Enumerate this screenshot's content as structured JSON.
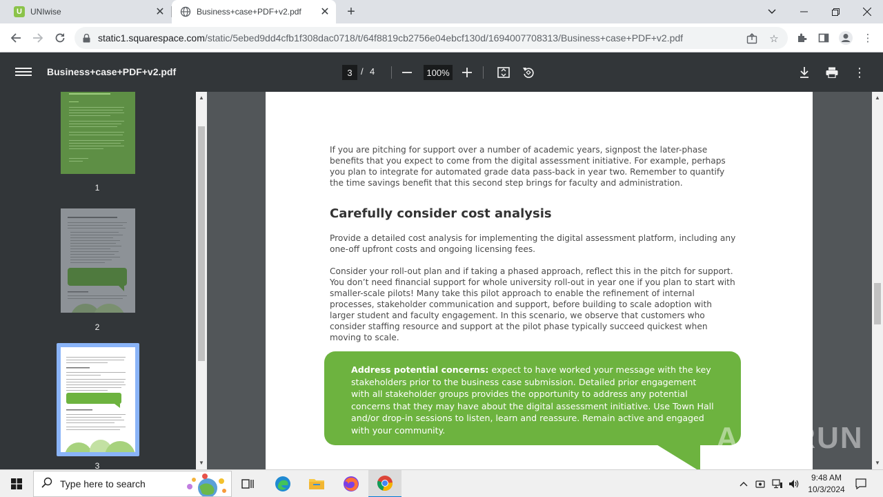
{
  "tabs": [
    {
      "title": "UNIwise",
      "favicon": "uniwise-icon"
    },
    {
      "title": "Business+case+PDF+v2.pdf",
      "favicon": "globe-icon"
    }
  ],
  "address": {
    "host": "static1.squarespace.com",
    "path": "/static/5ebed9dd4cfb1f308dac0718/t/64f8819cb2756e04ebcf130d/1694007708313/Business+case+PDF+v2.pdf"
  },
  "pdf_toolbar": {
    "title": "Business+case+PDF+v2.pdf",
    "current_page": "3",
    "separator": "/",
    "total_pages": "4",
    "zoom": "100%"
  },
  "thumbnails": [
    {
      "number": "1"
    },
    {
      "number": "2"
    },
    {
      "number": "3"
    }
  ],
  "page": {
    "intro_paragraph": "If you are pitching for support over a number of academic years, signpost the later-phase benefits that you expect to come from the digital assessment initiative. For example, perhaps you plan to integrate for automated grade data pass-back in year two. Remember to quantify the time savings benefit that this second step brings for faculty and administration.",
    "heading": "Carefully consider cost analysis",
    "paragraph_1": "Provide a detailed cost analysis for implementing the digital assessment platform, including any one-off upfront costs and ongoing licensing fees.",
    "paragraph_2": "Consider your roll-out plan and if taking a phased approach, reflect this in the pitch for support. You don’t need financial support for whole university roll-out in year one if you plan to start with smaller-scale pilots! Many take this pilot approach to enable the refinement of internal processes, stakeholder communication and support, before building to scale adoption with larger student and faculty engagement. In this scenario, we observe that customers who consider staffing resource and support at the pilot phase typically succeed quickest when moving to scale.",
    "callout_bold": "Address potential concerns:",
    "callout_text": " expect to have worked your message with the key stakeholders prior to the business case submission. Detailed prior engagement with all stakeholder groups provides the opportunity to address any potential concerns that they may have about the digital assessment initiative. Use Town Hall and/or drop-in sessions to listen, learn and reassure. Remain active and engaged with your community."
  },
  "watermark": "ANY RUN",
  "taskbar": {
    "search_placeholder": "Type here to search",
    "time": "9:48 AM",
    "date": "10/3/2024"
  },
  "colors": {
    "accent_green": "#6db33f",
    "pdf_toolbar": "#323639",
    "viewer_bg": "#525659"
  }
}
